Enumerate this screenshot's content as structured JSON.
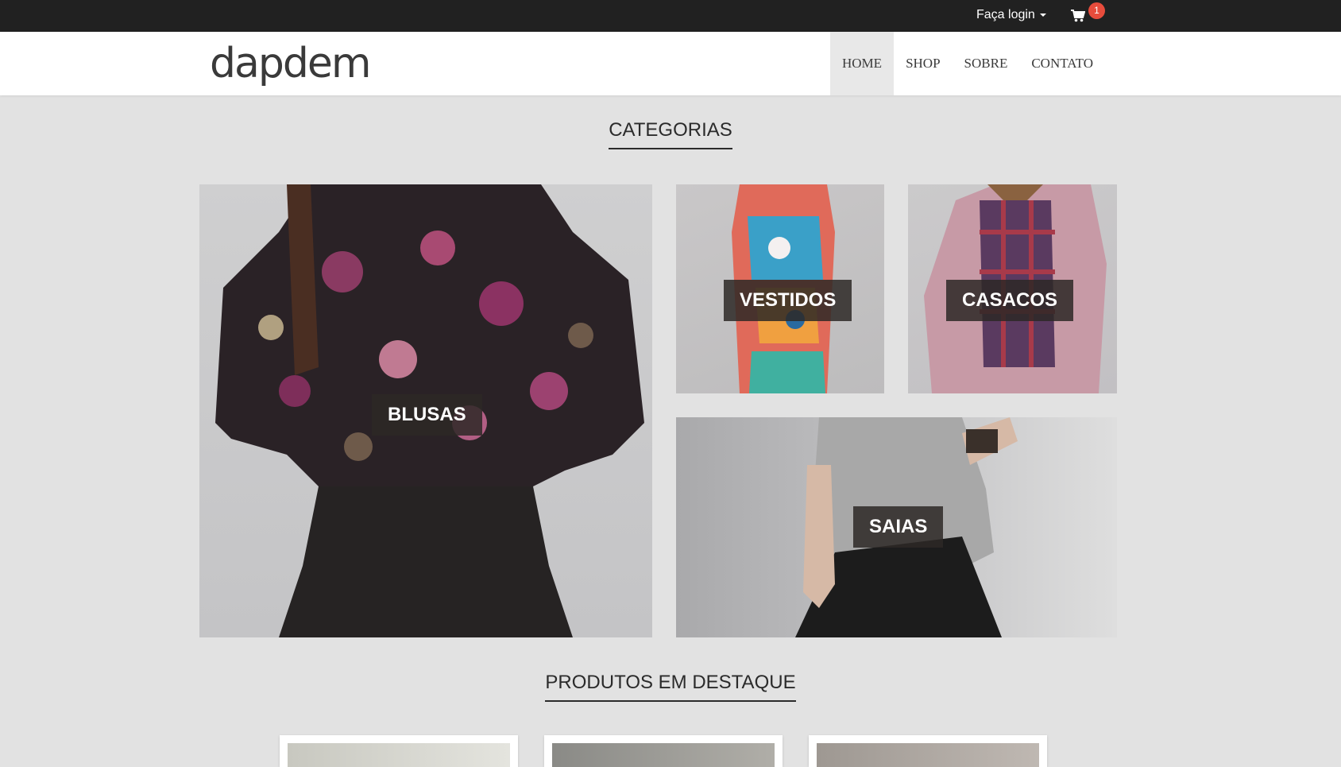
{
  "topbar": {
    "login_label": "Faça login",
    "cart_count": "1"
  },
  "navbar": {
    "logo_text": "dapdem",
    "menu": [
      {
        "label": "HOME",
        "active": true
      },
      {
        "label": "SHOP"
      },
      {
        "label": "SOBRE"
      },
      {
        "label": "CONTATO"
      }
    ]
  },
  "categories": {
    "title": "CATEGORIAS",
    "tiles": [
      {
        "label": "BLUSAS"
      },
      {
        "label": "VESTIDOS"
      },
      {
        "label": "CASACOS"
      },
      {
        "label": "SAIAS"
      }
    ]
  },
  "featured": {
    "title": "PRODUTOS EM DESTAQUE",
    "products_visible": 3
  },
  "colors": {
    "topbar_bg": "#212121",
    "page_bg": "#e2e2e2",
    "badge": "#e74c3c",
    "label_bg": "#2d2826"
  }
}
